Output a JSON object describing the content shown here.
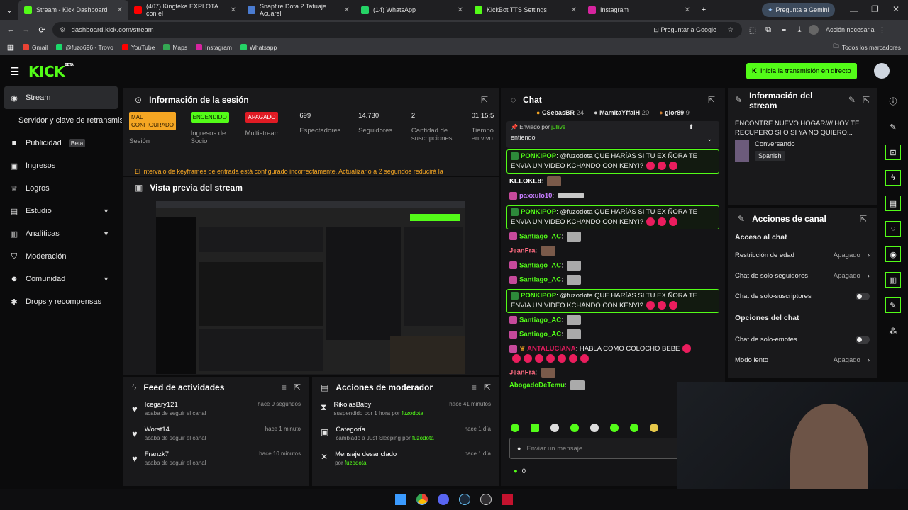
{
  "browser": {
    "tabs": [
      {
        "title": "Stream - Kick Dashboard",
        "color": "#53fc18"
      },
      {
        "title": "(407) Kingteka EXPLOTA con el",
        "color": "#ff0000"
      },
      {
        "title": "Snapfire Dota 2 Tatuaje Acuarel",
        "color": "#4a7bd0"
      },
      {
        "title": "(14) WhatsApp",
        "color": "#25d366"
      },
      {
        "title": "KickBot TTS Settings",
        "color": "#53fc18"
      },
      {
        "title": "Instagram",
        "color": "#d6249f"
      }
    ],
    "gemini_label": "Pregunta a Gemini",
    "url": "dashboard.kick.com/stream",
    "ask_google": "Preguntar a Google",
    "action_needed": "Acción necesaria",
    "bookmarks": [
      {
        "label": "Gmail",
        "color": "#ea4335"
      },
      {
        "label": "@fuzo696 - Trovo",
        "color": "#1bd96a"
      },
      {
        "label": "YouTube",
        "color": "#ff0000"
      },
      {
        "label": "Maps",
        "color": "#34a853"
      },
      {
        "label": "Instagram",
        "color": "#d6249f"
      },
      {
        "label": "Whatsapp",
        "color": "#25d366"
      }
    ],
    "all_bookmarks": "Todos los marcadores"
  },
  "kick": {
    "logo": "KICK",
    "logo_sup": "BETA",
    "start_stream": "Inicia la transmisión en directo",
    "accent": "#53fc18"
  },
  "sidebar": {
    "items": [
      {
        "label": "Stream",
        "icon": "broadcast-icon"
      },
      {
        "label": "Servidor y clave de retransmisión",
        "icon": ""
      },
      {
        "label": "Publicidad",
        "icon": "megaphone-icon",
        "badge": "Beta"
      },
      {
        "label": "Ingresos",
        "icon": "wallet-icon"
      },
      {
        "label": "Logros",
        "icon": "trophy-icon"
      },
      {
        "label": "Estudio",
        "icon": "studio-icon"
      },
      {
        "label": "Analíticas",
        "icon": "chart-icon"
      },
      {
        "label": "Moderación",
        "icon": "shield-icon"
      },
      {
        "label": "Comunidad",
        "icon": "community-icon"
      },
      {
        "label": "Drops y recompensas",
        "icon": "gift-icon"
      }
    ]
  },
  "session": {
    "title": "Información de la sesión",
    "stats": [
      {
        "value": "MAL CONFIGURADO",
        "label": "Sesión",
        "color": "#f5a623"
      },
      {
        "value": "ENCENDIDO",
        "label": "Ingresos de Socio",
        "color": "#53fc18"
      },
      {
        "value": "APAGADO",
        "label": "Multistream",
        "color": "#e01b24"
      },
      {
        "value": "699",
        "label": "Espectadores"
      },
      {
        "value": "14.730",
        "label": "Seguidores"
      },
      {
        "value": "2",
        "label": "Cantidad de suscripciones"
      },
      {
        "value": "01:15:5",
        "label": "Tiempo en vivo"
      }
    ],
    "warning": "El intervalo de keyframes de entrada está configurado incorrectamente. Actualizarlo a 2 segundos reducirá la"
  },
  "preview": {
    "title": "Vista previa del stream"
  },
  "feed": {
    "title": "Feed de actividades",
    "items": [
      {
        "user": "Icegary121",
        "action": "acaba de seguir el canal",
        "time": "hace 9 segundos"
      },
      {
        "user": "Worst14",
        "action": "acaba de seguir el canal",
        "time": "hace 1 minuto"
      },
      {
        "user": "Franzk7",
        "action": "acaba de seguir el canal",
        "time": "hace 10 minutos"
      }
    ]
  },
  "modactions": {
    "title": "Acciones de moderador",
    "items": [
      {
        "title": "RikolasBaby",
        "detail": "suspendido por 1 hora por",
        "by": "fuzodota",
        "time": "hace 41 minutos"
      },
      {
        "title": "Categoría",
        "detail": "cambiado a Just Sleeping por",
        "by": "fuzodota",
        "time": "hace 1 día"
      },
      {
        "title": "Mensaje desanclado",
        "detail": "por",
        "by": "fuzodota",
        "time": "hace 1 día"
      }
    ]
  },
  "chat": {
    "title": "Chat",
    "top": [
      {
        "name": "CSebasBR",
        "n": "24"
      },
      {
        "name": "MamitaYffaiH",
        "n": "20"
      },
      {
        "name": "gior89",
        "n": "9"
      }
    ],
    "pinned_by_label": "Enviado por",
    "pinned_by": "jullive",
    "pinned_text": "entiendo",
    "messages": [
      {
        "user": "PONKIPOP",
        "text": "@fuzodota QUE HARÍAS SI TU EX ÑORA TE ENVIA UN VIDEO KCHANDO CON KENYI?",
        "color": "#53fc18",
        "hl": true
      },
      {
        "user": "KELOKE8",
        "text": "",
        "color": "#ffffff"
      },
      {
        "user": "paxxulo10",
        "text": "",
        "color": "#c77dff"
      },
      {
        "user": "PONKIPOP",
        "text": "@fuzodota QUE HARÍAS SI TU EX ÑORA TE ENVIA UN VIDEO KCHANDO CON KENYI?",
        "color": "#53fc18",
        "hl": true
      },
      {
        "user": "Santiago_AC",
        "text": "",
        "color": "#53fc18"
      },
      {
        "user": "JeanFra",
        "text": "",
        "color": "#ff6b81"
      },
      {
        "user": "Santiago_AC",
        "text": "",
        "color": "#53fc18"
      },
      {
        "user": "Santiago_AC",
        "text": "",
        "color": "#53fc18"
      },
      {
        "user": "PONKIPOP",
        "text": "@fuzodota QUE HARÍAS SI TU EX ÑORA TE ENVIA UN VIDEO KCHANDO CON KENYI?",
        "color": "#53fc18",
        "hl": true
      },
      {
        "user": "Santiago_AC",
        "text": "",
        "color": "#53fc18"
      },
      {
        "user": "Santiago_AC",
        "text": "",
        "color": "#53fc18"
      },
      {
        "user": "ANTALUCIANA",
        "text": "HABLA COMO COLOCHO BEBE",
        "color": "#e01b5d"
      },
      {
        "user": "JeanFra",
        "text": "",
        "color": "#ff6b81"
      },
      {
        "user": "AbogadoDeTemu",
        "text": "",
        "color": "#53fc18"
      }
    ],
    "input_placeholder": "Enviar un mensaje",
    "points": "0"
  },
  "streaminfo": {
    "title": "Información del stream",
    "stream_title": "ENCONTRÉ NUEVO HOGAR//// HOY TE RECUPERO SI O SI YA NO QUIERO...",
    "category": "Conversando",
    "language": "Spanish"
  },
  "channel": {
    "title": "Acciones de canal",
    "chat_access": "Acceso al chat",
    "age": "Restricción de edad",
    "age_val": "Apagado",
    "followers": "Chat de solo-seguidores",
    "followers_val": "Apagado",
    "subs": "Chat de solo-suscriptores",
    "chat_options": "Opciones del chat",
    "emotes": "Chat de solo-emotes",
    "slow": "Modo lento",
    "slow_val": "Apagado"
  }
}
